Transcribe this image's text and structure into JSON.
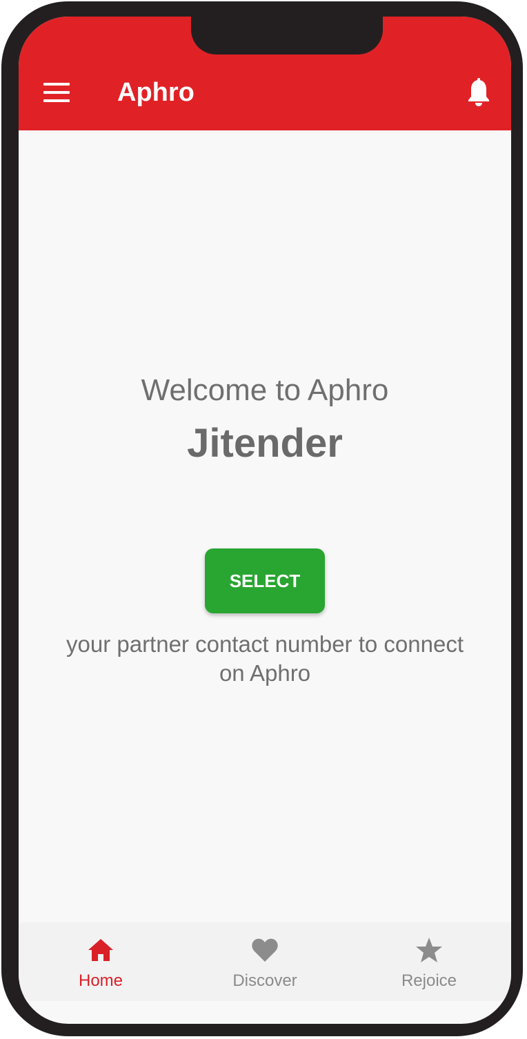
{
  "app_bar": {
    "title": "Aphro",
    "menu_icon": "hamburger-menu-icon",
    "notification_icon": "bell-icon",
    "background_color": "#e02226"
  },
  "main": {
    "welcome_text": "Welcome to Aphro",
    "user_name": "Jitender",
    "select_button_label": "SELECT",
    "select_button_color": "#29a531",
    "instruction_text": "your partner contact number to connect on Aphro"
  },
  "bottom_nav": {
    "active_color": "#d92027",
    "inactive_color": "#8a8a8a",
    "items": [
      {
        "label": "Home",
        "icon": "home-icon",
        "active": true
      },
      {
        "label": "Discover",
        "icon": "heart-icon",
        "active": false
      },
      {
        "label": "Rejoice",
        "icon": "star-icon",
        "active": false
      }
    ]
  }
}
